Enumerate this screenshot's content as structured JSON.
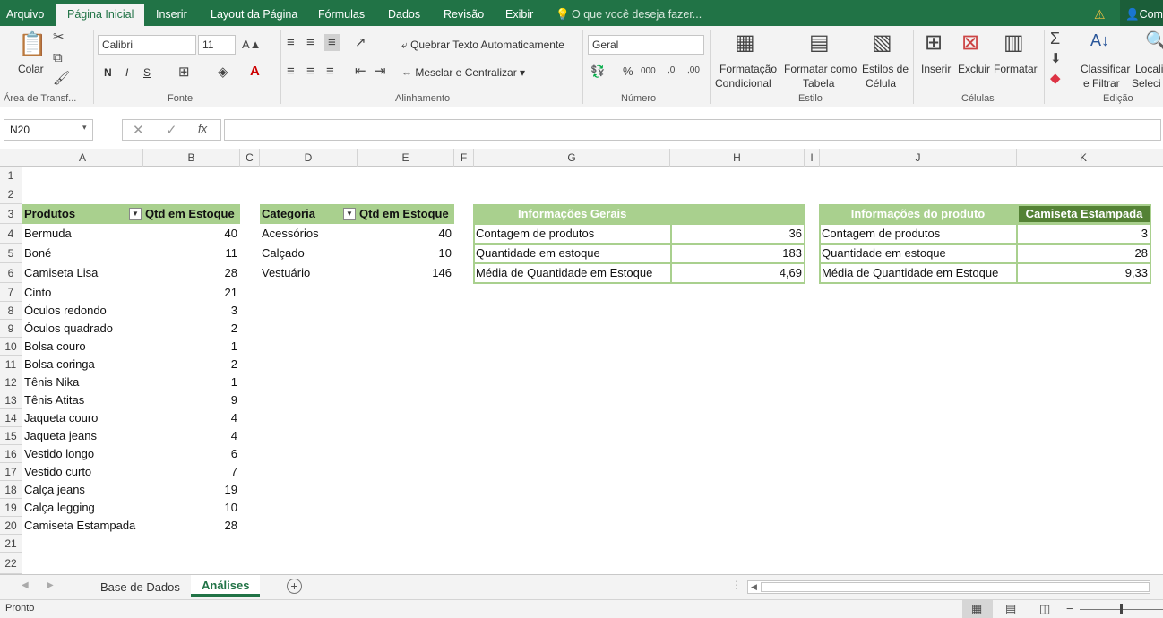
{
  "menu": {
    "tabs": [
      "Arquivo",
      "Página Inicial",
      "Inserir",
      "Layout da Página",
      "Fórmulas",
      "Dados",
      "Revisão",
      "Exibir"
    ],
    "tell_me": "O que você deseja fazer...",
    "share": "Com"
  },
  "ribbon": {
    "paste": "Colar",
    "clipboard_group": "Área de Transf...",
    "font_name": "Calibri",
    "font_size": "11",
    "bold": "N",
    "italic": "I",
    "underline": "S",
    "font_group": "Fonte",
    "wrap_text": "Quebrar Texto Automaticamente",
    "merge_center": "Mesclar e Centralizar",
    "alignment_group": "Alinhamento",
    "number_format": "Geral",
    "number_group": "Número",
    "cond_format_1": "Formatação",
    "cond_format_2": "Condicional",
    "format_table_1": "Formatar como",
    "format_table_2": "Tabela",
    "cell_styles_1": "Estilos de",
    "cell_styles_2": "Célula",
    "styles_group": "Estilo",
    "insert": "Inserir",
    "delete": "Excluir",
    "format": "Formatar",
    "cells_group": "Células",
    "sort_1": "Classificar",
    "sort_2": "e Filtrar",
    "find_1": "Locali",
    "find_2": "Seleci",
    "editing_group": "Edição"
  },
  "formula_bar": {
    "name_box": "N20",
    "fx": "fx",
    "value": ""
  },
  "columns": [
    "A",
    "B",
    "C",
    "D",
    "E",
    "F",
    "G",
    "H",
    "I",
    "J",
    "K"
  ],
  "rows": [
    "1",
    "2",
    "3",
    "4",
    "5",
    "6",
    "7",
    "8",
    "9",
    "10",
    "11",
    "12",
    "13",
    "14",
    "15",
    "16",
    "17",
    "18",
    "19",
    "20",
    "21",
    "22"
  ],
  "table1": {
    "headers": [
      "Produtos",
      "Qtd em Estoque"
    ],
    "rows": [
      [
        "Bermuda",
        "40"
      ],
      [
        "Boné",
        "11"
      ],
      [
        "Camiseta Lisa",
        "28"
      ],
      [
        "Cinto",
        "21"
      ],
      [
        "Óculos redondo",
        "3"
      ],
      [
        "Óculos quadrado",
        "2"
      ],
      [
        "Bolsa couro",
        "1"
      ],
      [
        "Bolsa coringa",
        "2"
      ],
      [
        "Tênis Nika",
        "1"
      ],
      [
        "Tênis Atitas",
        "9"
      ],
      [
        "Jaqueta couro",
        "4"
      ],
      [
        "Jaqueta jeans",
        "4"
      ],
      [
        "Vestido longo",
        "6"
      ],
      [
        "Vestido curto",
        "7"
      ],
      [
        "Calça jeans",
        "19"
      ],
      [
        "Calça legging",
        "10"
      ],
      [
        "Camiseta Estampada",
        "28"
      ]
    ]
  },
  "table2": {
    "headers": [
      "Categoria",
      "Qtd em Estoque"
    ],
    "rows": [
      [
        "Acessórios",
        "40"
      ],
      [
        "Calçado",
        "10"
      ],
      [
        "Vestuário",
        "146"
      ]
    ]
  },
  "info_general": {
    "title": "Informações Gerais",
    "rows": [
      [
        "Contagem de produtos",
        "36"
      ],
      [
        "Quantidade em estoque",
        "183"
      ],
      [
        "Média de Quantidade em Estoque",
        "4,69"
      ]
    ]
  },
  "info_product": {
    "title": "Informações do produto",
    "product": "Camiseta Estampada",
    "rows": [
      [
        "Contagem de produtos",
        "3"
      ],
      [
        "Quantidade em estoque",
        "28"
      ],
      [
        "Média de Quantidade em Estoque",
        "9,33"
      ]
    ]
  },
  "sheets": [
    "Base de Dados",
    "Análises"
  ],
  "status": "Pronto",
  "colors": {
    "excel_green": "#217346",
    "table_header": "#a9d08e",
    "dark_green": "#548235"
  }
}
